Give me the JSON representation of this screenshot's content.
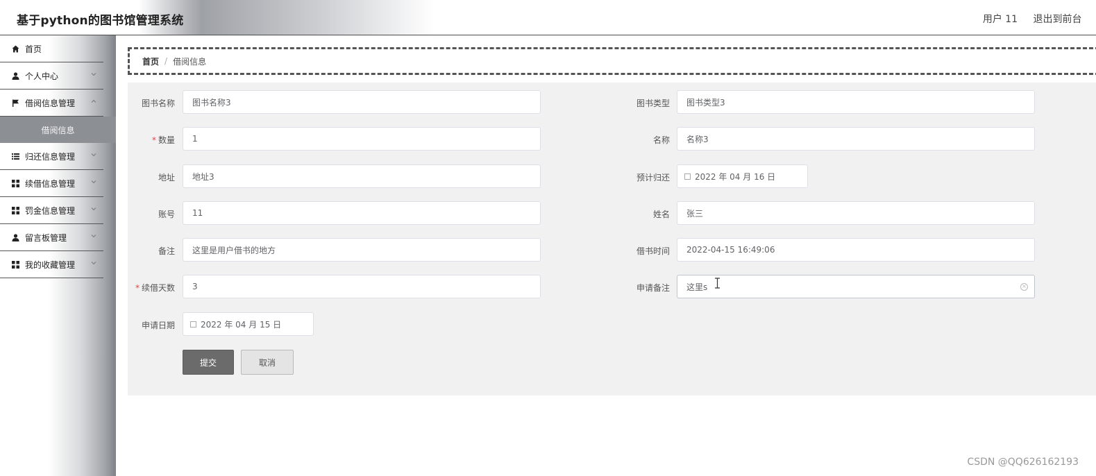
{
  "header": {
    "title": "基于python的图书馆管理系统",
    "user": "用户 11",
    "to_front": "退出到前台",
    "logout": "退出"
  },
  "sidebar": {
    "items": [
      {
        "label": "首页",
        "icon": "home-icon"
      },
      {
        "label": "个人中心",
        "icon": "person-icon"
      },
      {
        "label": "借阅信息管理",
        "icon": "flag-icon"
      },
      {
        "label": "归还信息管理",
        "icon": "list-icon"
      },
      {
        "label": "续借信息管理",
        "icon": "grid-icon"
      },
      {
        "label": "罚金信息管理",
        "icon": "grid-icon"
      },
      {
        "label": "留言板管理",
        "icon": "person-icon"
      },
      {
        "label": "我的收藏管理",
        "icon": "grid-icon"
      }
    ],
    "active_sub": "借阅信息"
  },
  "breadcrumb": {
    "home": "首页",
    "separator": "/",
    "current": "借阅信息"
  },
  "form": {
    "book_name": {
      "label": "图书名称",
      "value": "图书名称3"
    },
    "book_type": {
      "label": "图书类型",
      "value": "图书类型3"
    },
    "quantity": {
      "label": "数量",
      "value": "1"
    },
    "name": {
      "label": "名称",
      "value": "名称3"
    },
    "address": {
      "label": "地址",
      "value": "地址3"
    },
    "expected_return": {
      "label": "预计归还",
      "value": "2022 年 04 月 16 日"
    },
    "account": {
      "label": "账号",
      "value": "11"
    },
    "person_name": {
      "label": "姓名",
      "value": "张三"
    },
    "remark": {
      "label": "备注",
      "value": "这里是用户借书的地方"
    },
    "borrow_time": {
      "label": "借书时间",
      "value": "2022-04-15 16:49:06"
    },
    "renew_days": {
      "label": "续借天数",
      "value": "3"
    },
    "apply_remark": {
      "label": "申请备注",
      "value": "这里s"
    },
    "apply_date": {
      "label": "申请日期",
      "value": "2022 年 04 月 15 日"
    },
    "required_mark": "*"
  },
  "buttons": {
    "submit": "提交",
    "cancel": "取消"
  },
  "watermark": "CSDN @QQ626162193"
}
